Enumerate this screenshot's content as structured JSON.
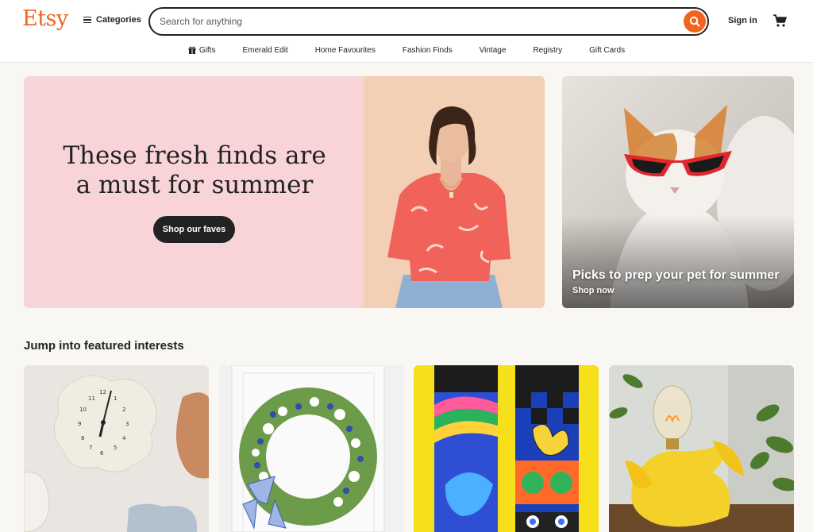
{
  "header": {
    "logo": "Etsy",
    "categories_label": "Categories",
    "search_placeholder": "Search for anything",
    "signin_label": "Sign in"
  },
  "nav": {
    "items": [
      "Gifts",
      "Emerald Edit",
      "Home Favourites",
      "Fashion Finds",
      "Vintage",
      "Registry",
      "Gift Cards"
    ]
  },
  "hero": {
    "headline_line1": "These fresh finds are",
    "headline_line2": "a must for summer",
    "button_label": "Shop our faves",
    "background": "#f8d4d9"
  },
  "pet_promo": {
    "title": "Picks to prep your pet for summer",
    "cta": "Shop now"
  },
  "featured": {
    "title": "Jump into featured interests",
    "cards": [
      "wall-clocks",
      "wreath",
      "socks",
      "banana-lamp"
    ]
  },
  "colors": {
    "brand": "#f1641e",
    "dark": "#222222"
  }
}
